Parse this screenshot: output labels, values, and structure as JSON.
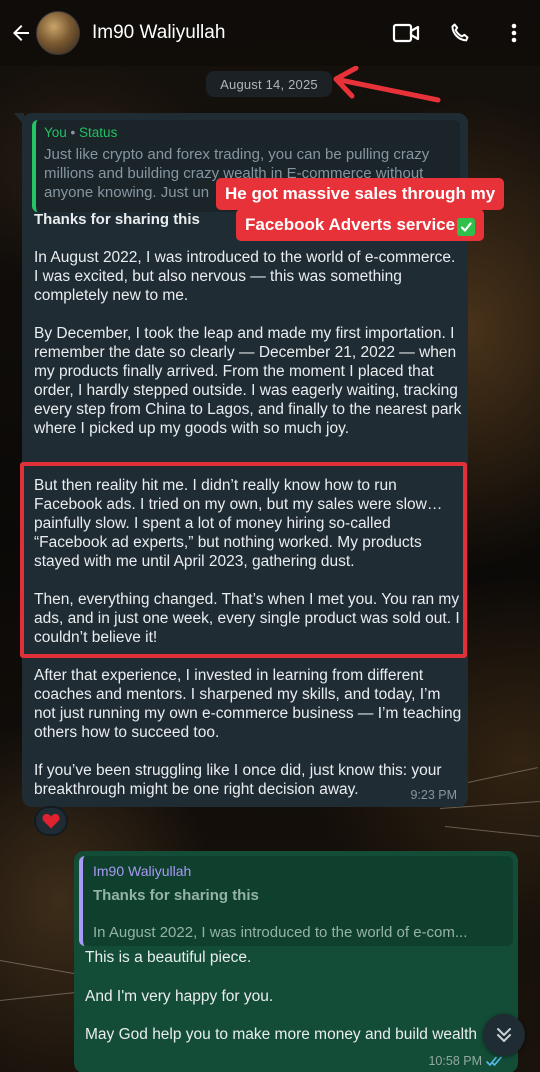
{
  "header": {
    "contact_name": "Im90 Waliyullah",
    "icons": [
      "back-arrow-icon",
      "video-call-icon",
      "voice-call-icon",
      "more-vert-icon"
    ]
  },
  "date_chip": "August 14, 2025",
  "incoming": {
    "quote": {
      "author": "You",
      "separator": "•",
      "source": "Status",
      "text": "Just like crypto and forex trading, you can be pulling crazy millions and building crazy wealth in E-commerce without anyone knowing. Just un"
    },
    "title": "Thanks for sharing this",
    "paragraphs": [
      "In August 2022, I was introduced to the world of e-commerce. I was excited, but also nervous — this was something completely new to me.",
      "By December, I took the leap and made my first importation. I remember the date so clearly — December 21, 2022 — when my products finally arrived. From the moment I placed that order, I hardly stepped outside. I was eagerly waiting, tracking every step from China to Lagos, and finally to the nearest park where I picked up my goods with so much joy.",
      "But then reality hit me. I didn’t really know how to run Facebook ads. I tried on my own, but my sales were slow… painfully slow. I spent a lot of money hiring so-called “Facebook ad experts,” but nothing worked. My products stayed with me until April 2023, gathering dust.",
      "Then, everything changed. That’s when I met you. You ran my ads, and in just one week, every single product was sold out. I couldn’t believe it!",
      "After that experience, I invested in learning from different coaches and mentors. I sharpened my skills, and today, I’m not just running my own e-commerce business — I’m teaching others how to succeed too.",
      "If you’ve been struggling like I once did, just know this: your breakthrough might be one right decision away."
    ],
    "time": "9:23 PM",
    "reaction": "❤️"
  },
  "annotation": {
    "banner_line1": "He got massive sales through my",
    "banner_line2": "Facebook Adverts service",
    "color": "#e8323a"
  },
  "outgoing": {
    "quote": {
      "author": "Im90 Waliyullah",
      "title": "Thanks for sharing this",
      "text": "In August 2022, I was introduced to the world of e-com..."
    },
    "lines": [
      "This is a beautiful piece.",
      "And I'm very happy for you.",
      "May God help you to make more money and build wealth"
    ],
    "time": "10:58 PM",
    "status_icon": "double-check-read-icon"
  },
  "colors": {
    "incoming_bubble": "#202c33",
    "outgoing_bubble": "#144d37",
    "accent_green": "#21c063",
    "read_tick": "#53bdeb"
  }
}
